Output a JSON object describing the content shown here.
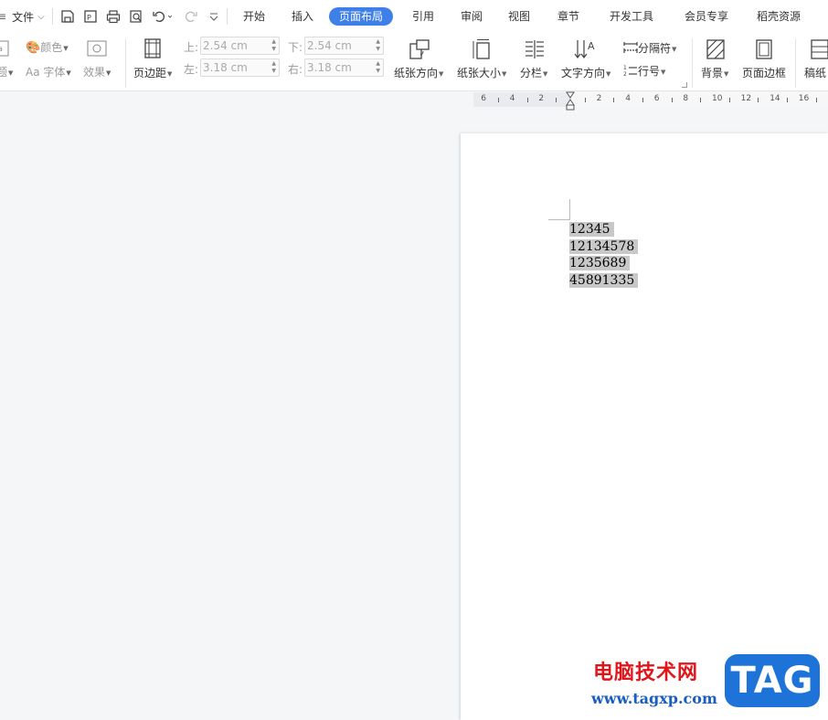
{
  "menubar": {
    "file_label": "文件",
    "tabs": [
      "开始",
      "插入",
      "页面布局",
      "引用",
      "审阅",
      "视图",
      "章节",
      "开发工具",
      "会员专享",
      "稻壳资源"
    ],
    "active_tab": "页面布局"
  },
  "ribbon": {
    "theme_label": "题",
    "color_label": "颜色",
    "font_label": "Aa 字体",
    "effect_label": "效果",
    "margin_label": "页边距",
    "top_label": "上:",
    "top_value": "2.54 cm",
    "bottom_label": "下:",
    "bottom_value": "2.54 cm",
    "left_label": "左:",
    "left_value": "3.18 cm",
    "right_label": "右:",
    "right_value": "3.18 cm",
    "orientation_label": "纸张方向",
    "size_label": "纸张大小",
    "columns_label": "分栏",
    "text_direction_label": "文字方向",
    "break_label": "分隔符",
    "line_number_label": "行号",
    "background_label": "背景",
    "page_border_label": "页面边框",
    "manuscript_label": "稿纸"
  },
  "ruler": {
    "labels": [
      "6",
      "4",
      "2",
      "2",
      "4",
      "6",
      "8",
      "10",
      "12",
      "14",
      "16"
    ]
  },
  "document": {
    "lines": [
      "12345",
      "12134578",
      "1235689",
      "45891335"
    ]
  },
  "watermark": {
    "site_name": "电脑技术网",
    "url": "www.tagxp.com",
    "badge": "TAG"
  },
  "colors": {
    "accent": "#3f7fe8",
    "selection": "#c8c8c8",
    "watermark_red": "#e0161b",
    "watermark_blue": "#1e73d8"
  }
}
